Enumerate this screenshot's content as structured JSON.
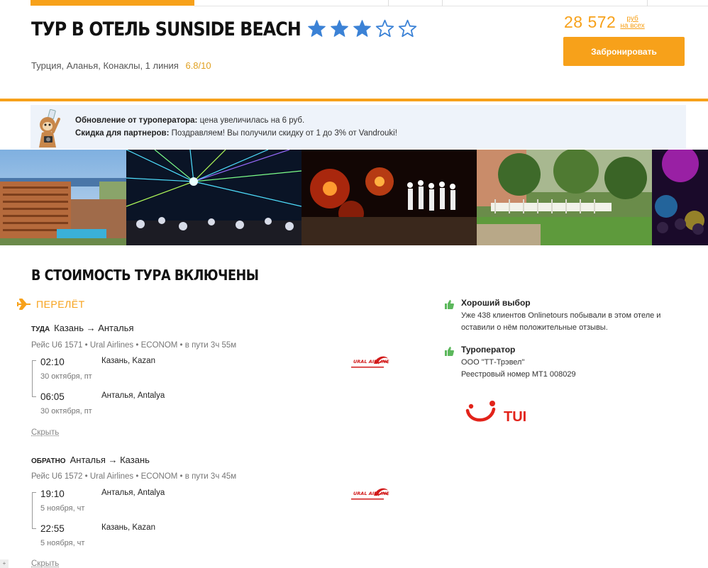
{
  "header": {
    "hotel_title": "ТУР В ОТЕЛЬ SUNSIDE BEACH",
    "stars_filled": 3,
    "stars_total": 5,
    "location": "Турция, Аланья, Конаклы, 1 линия",
    "rating": "6.8/10",
    "price_value": "28 572",
    "price_currency": "руб",
    "price_note": "на всех",
    "book_button": "Забронировать"
  },
  "notice": {
    "line1_bold": "Обновление от туроператора:",
    "line1_text": " цена увеличилась на 6 руб.",
    "line2_bold": "Скидка для партнеров:",
    "line2_text": " Поздравляем! Вы получили скидку от 1 до 3% от Vandrouki!"
  },
  "included": {
    "title": "В СТОИМОСТЬ ТУРА ВКЛЮЧЕНЫ",
    "flight_heading": "ПЕРЕЛЁТ",
    "outbound": {
      "tag": "ТУДА",
      "route": "Казань → Анталья",
      "meta": "Рейс U6 1571 • Ural Airlines • ECONOM • в пути 3ч 55м",
      "dep_time": "02:10",
      "dep_date": "30 октября, пт",
      "dep_city": "Казань, Kazan",
      "arr_time": "06:05",
      "arr_date": "30 октября, пт",
      "arr_city": "Анталья, Antalya",
      "hide": "Скрыть"
    },
    "return": {
      "tag": "ОБРАТНО",
      "route": "Анталья → Казань",
      "meta": "Рейс U6 1572 • Ural Airlines • ECONOM • в пути 3ч 45м",
      "dep_time": "19:10",
      "dep_date": "5 ноября, чт",
      "dep_city": "Анталья, Antalya",
      "arr_time": "22:55",
      "arr_date": "5 ноября, чт",
      "arr_city": "Казань, Kazan",
      "hide": "Скрыть"
    },
    "airline_logo_text": "URAL AIRLINES"
  },
  "side": {
    "good_choice_title": "Хороший выбор",
    "good_choice_text": "Уже 438 клиентов Onlinetours побывали в этом отеле и оставили о нём положительные отзывы.",
    "operator_title": "Туроператор",
    "operator_name": "ООО \"ТТ-Трэвел\"",
    "operator_reg": "Реестровый номер МТ1 008029",
    "operator_logo_text": "TUI"
  },
  "colors": {
    "accent": "#f7a11a",
    "star": "#3b82d6",
    "thumb": "#5cb85c",
    "brand_red": "#e2231a"
  },
  "icons": [
    "star-icon",
    "airplane-icon",
    "thumbs-up-icon",
    "mascot-icon"
  ]
}
